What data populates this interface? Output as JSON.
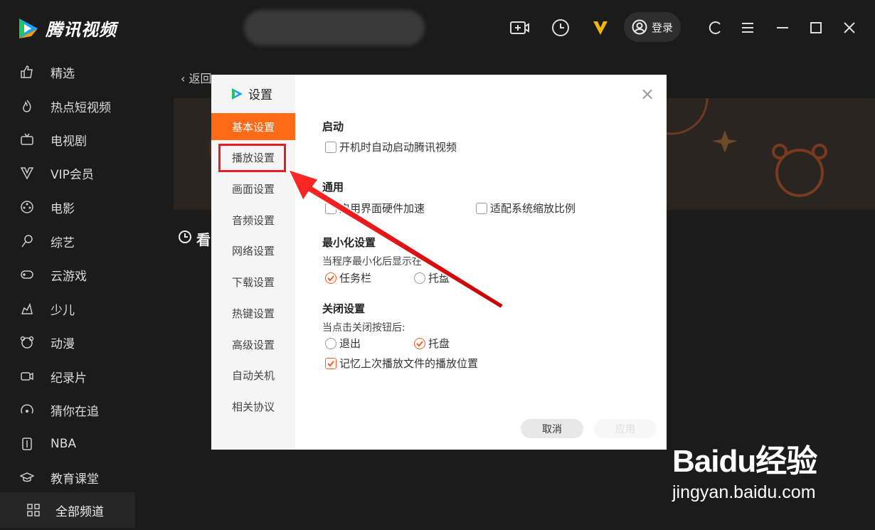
{
  "app": {
    "name": "腾讯视频",
    "login": "登录"
  },
  "sidebar": {
    "items": [
      {
        "label": "精选",
        "icon": "thumbs-up-icon"
      },
      {
        "label": "热点短视频",
        "icon": "flame-icon"
      },
      {
        "label": "电视剧",
        "icon": "tv-icon"
      },
      {
        "label": "VIP会员",
        "icon": "vip-icon"
      },
      {
        "label": "电影",
        "icon": "film-reel-icon"
      },
      {
        "label": "综艺",
        "icon": "microphone-icon"
      },
      {
        "label": "云游戏",
        "icon": "gamepad-icon"
      },
      {
        "label": "少儿",
        "icon": "child-icon"
      },
      {
        "label": "动漫",
        "icon": "bear-icon"
      },
      {
        "label": "纪录片",
        "icon": "camera-icon"
      },
      {
        "label": "猜你在追",
        "icon": "radar-icon"
      },
      {
        "label": "NBA",
        "icon": "basketball-icon"
      },
      {
        "label": "教育课堂",
        "icon": "graduation-cap-icon"
      }
    ],
    "all_channels": "全部频道"
  },
  "main": {
    "back": "返回",
    "history_title": "看"
  },
  "dialog": {
    "title": "设置",
    "tabs": [
      "基本设置",
      "播放设置",
      "画面设置",
      "音频设置",
      "网络设置",
      "下载设置",
      "热键设置",
      "高级设置",
      "自动关机",
      "相关协议"
    ],
    "active_tab": "基本设置",
    "startup": {
      "title": "启动",
      "auto_start": "开机时自动启动腾讯视频",
      "auto_start_checked": false
    },
    "general": {
      "title": "通用",
      "hw_accel": "启用界面硬件加速",
      "hw_accel_checked": false,
      "scale": "适配系统缩放比例",
      "scale_checked": false
    },
    "minimize": {
      "title": "最小化设置",
      "desc": "当程序最小化后显示在",
      "opt_taskbar": "任务栏",
      "opt_tray": "托盘",
      "selected": "任务栏"
    },
    "close": {
      "title": "关闭设置",
      "desc": "当点击关闭按钮后:",
      "opt_exit": "退出",
      "opt_tray": "托盘",
      "selected": "托盘",
      "remember": "记忆上次播放文件的播放位置",
      "remember_checked": true
    },
    "buttons": {
      "cancel": "取消",
      "apply": "应用"
    }
  },
  "watermark": {
    "brand": "Baidu经验",
    "url": "jingyan.baidu.com"
  },
  "colors": {
    "accent": "#ff6a17",
    "highlight": "#e31e24"
  }
}
